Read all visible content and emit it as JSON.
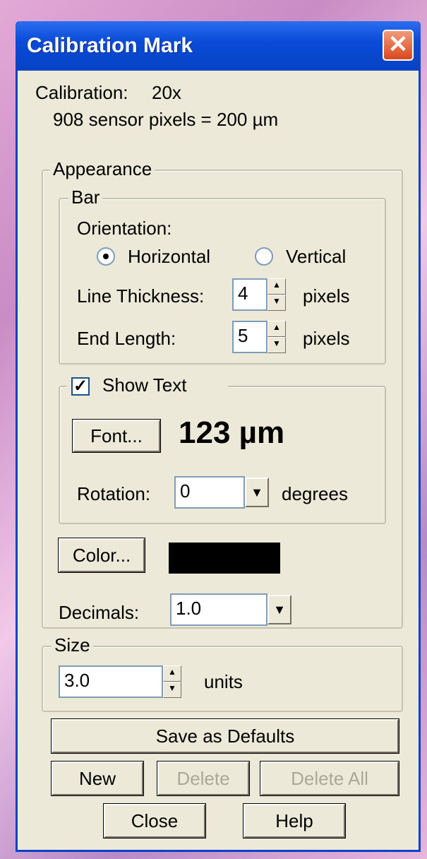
{
  "window": {
    "title": "Calibration Mark",
    "close_glyph": "✕"
  },
  "calibration": {
    "label": "Calibration:",
    "value": "20x",
    "detail": "908 sensor pixels = 200 µm"
  },
  "appearance": {
    "legend": "Appearance",
    "bar": {
      "legend": "Bar",
      "orientation_label": "Orientation:",
      "horizontal_label": "Horizontal",
      "vertical_label": "Vertical",
      "selected": "horizontal",
      "line_thickness_label": "Line Thickness:",
      "line_thickness_value": "4",
      "line_thickness_unit": "pixels",
      "end_length_label": "End Length:",
      "end_length_value": "5",
      "end_length_unit": "pixels"
    },
    "show_text": {
      "label": "Show Text",
      "checked": true,
      "check_glyph": "✓",
      "font_button": "Font...",
      "preview": "123 µm",
      "rotation_label": "Rotation:",
      "rotation_value": "0",
      "rotation_unit": "degrees"
    },
    "color_button": "Color...",
    "color_value": "#000000",
    "decimals_label": "Decimals:",
    "decimals_value": "1.0"
  },
  "size": {
    "legend": "Size",
    "value": "3.0",
    "unit": "units"
  },
  "buttons": {
    "save_defaults": "Save as Defaults",
    "new": "New",
    "delete": "Delete",
    "delete_all": "Delete All",
    "close": "Close",
    "help": "Help"
  },
  "icons": {
    "spin_up": "▲",
    "spin_down": "▼",
    "combo_down": "▼"
  }
}
